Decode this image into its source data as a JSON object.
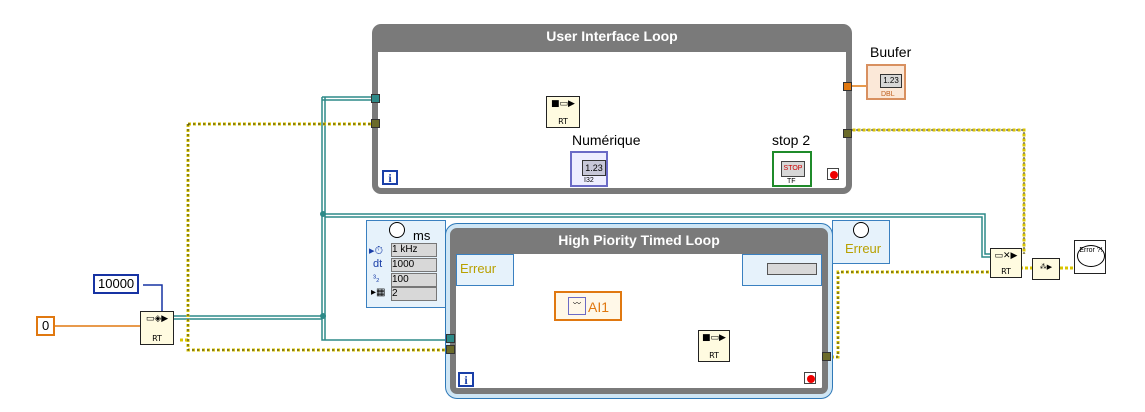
{
  "loops": {
    "ui_loop_title": "User Interface Loop",
    "timed_loop_title": "High Piority Timed Loop",
    "iteration_symbol": "i"
  },
  "labels": {
    "buffer": "Buufer",
    "numeric": "Numérique",
    "stop": "stop 2",
    "ms": "ms"
  },
  "constants": {
    "queue_size": "10000",
    "zero": "0"
  },
  "timing_config": {
    "frequency": "1 kHz",
    "dt_label": "dt",
    "period": "1000",
    "offset": "100",
    "priority": "2"
  },
  "error_cluster": {
    "left_label": "Erreur",
    "right_label": "Erreur"
  },
  "daq": {
    "channel": "AI1"
  },
  "indicators": {
    "numeric_display": "1.23",
    "buffer_display": "1.23",
    "buffer_type": "DBL",
    "numeric_type": "I32",
    "stop_text": "STOP",
    "stop_type": "TF"
  },
  "subvi_labels": {
    "bt": "RT"
  },
  "error_handler": {
    "text": "Error ?!"
  }
}
